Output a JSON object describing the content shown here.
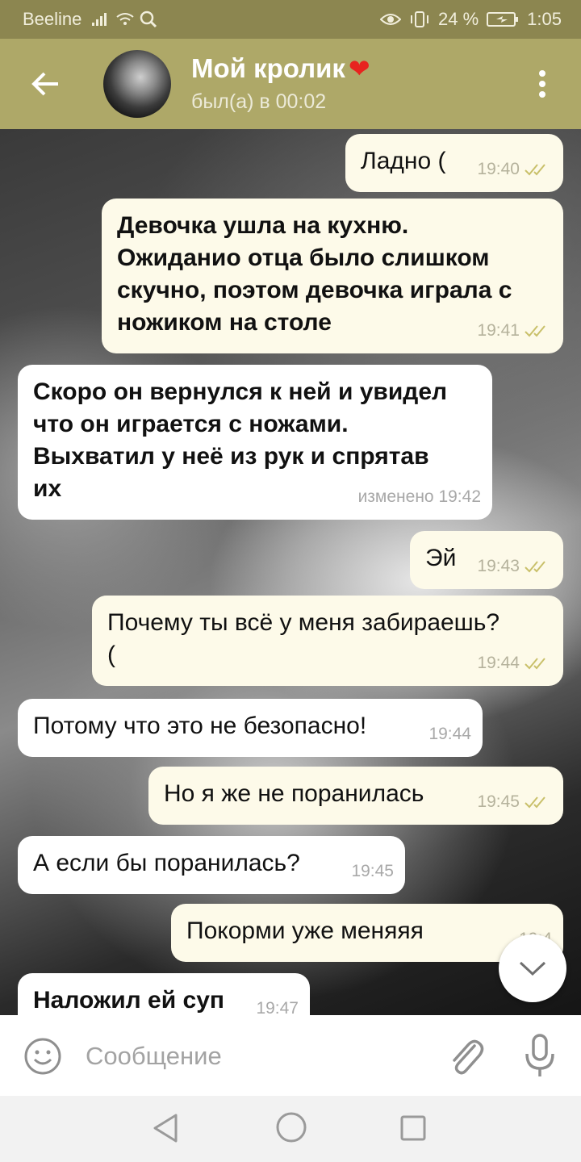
{
  "status_bar": {
    "carrier": "Beeline",
    "battery": "24 %",
    "time": "1:05"
  },
  "header": {
    "title": "Мой кролик",
    "title_emoji": "❤",
    "status": "был(а) в 00:02",
    "back_icon": "arrow-left-icon",
    "menu_icon": "more-vertical-icon"
  },
  "messages": [
    {
      "dir": "out",
      "text": "Ладно (",
      "time": "19:40"
    },
    {
      "dir": "out",
      "text": "Девочка ушла на кухню.\nОжиданио отца было слишком\nскучно, поэтом девочка играла с\nножиком на столе",
      "time": "19:41"
    },
    {
      "dir": "in",
      "text": "Скоро он вернулся к ней и увидел\nчто он играется с ножами.\nВыхватил у неё из рук и спрятав\nих",
      "time": "изменено 19:42"
    },
    {
      "dir": "out",
      "text": "Эй",
      "time": "19:43"
    },
    {
      "dir": "out",
      "text": "Почему ты всё у меня забираешь?\n(",
      "time": "19:44"
    },
    {
      "dir": "in",
      "text": "Потому что это не безопасно!",
      "time": "19:44"
    },
    {
      "dir": "out",
      "text": "Но я же не поранилась",
      "time": "19:45"
    },
    {
      "dir": "in",
      "text": "А если бы поранилась?",
      "time": "19:45"
    },
    {
      "dir": "out",
      "text": "Покорми уже меняяя",
      "time": "19:4"
    },
    {
      "dir": "in",
      "text": "Наложил ей суп",
      "time": "19:47"
    }
  ],
  "composer": {
    "placeholder": "Сообщение",
    "emoji_icon": "smiley-icon",
    "attach_icon": "paperclip-icon",
    "mic_icon": "microphone-icon"
  },
  "colors": {
    "header": "#aea868",
    "status_bar": "#8c8650",
    "outgoing_bubble": "#fdfae9",
    "incoming_bubble": "#ffffff",
    "read_ticks": "#c9c06a"
  }
}
